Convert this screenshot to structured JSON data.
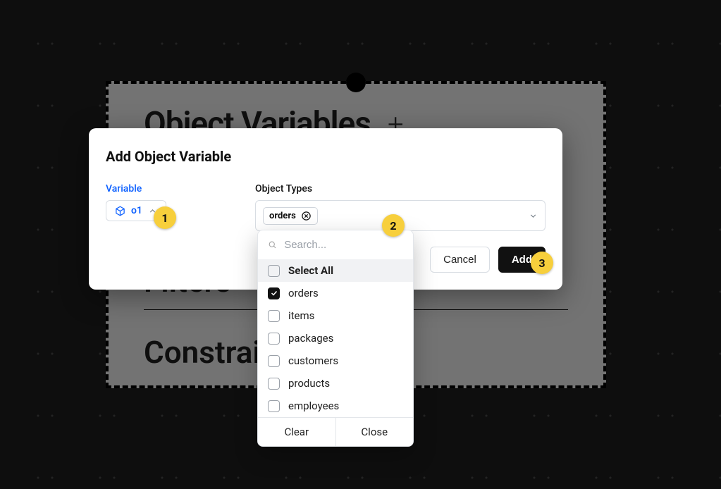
{
  "background": {
    "section_title": "Object Variables",
    "filters_label": "Filters",
    "constraints_label": "Constraints"
  },
  "modal": {
    "title": "Add Object Variable",
    "variable_label": "Variable",
    "variable_value": "o1",
    "object_types_label": "Object Types",
    "selected_chip": "orders",
    "cancel_label": "Cancel",
    "add_label": "Add"
  },
  "dropdown": {
    "search_placeholder": "Search...",
    "select_all_label": "Select All",
    "options": [
      {
        "label": "orders",
        "checked": true
      },
      {
        "label": "items",
        "checked": false
      },
      {
        "label": "packages",
        "checked": false
      },
      {
        "label": "customers",
        "checked": false
      },
      {
        "label": "products",
        "checked": false
      },
      {
        "label": "employees",
        "checked": false
      }
    ],
    "clear_label": "Clear",
    "close_label": "Close"
  },
  "callouts": [
    "1",
    "2",
    "3"
  ]
}
